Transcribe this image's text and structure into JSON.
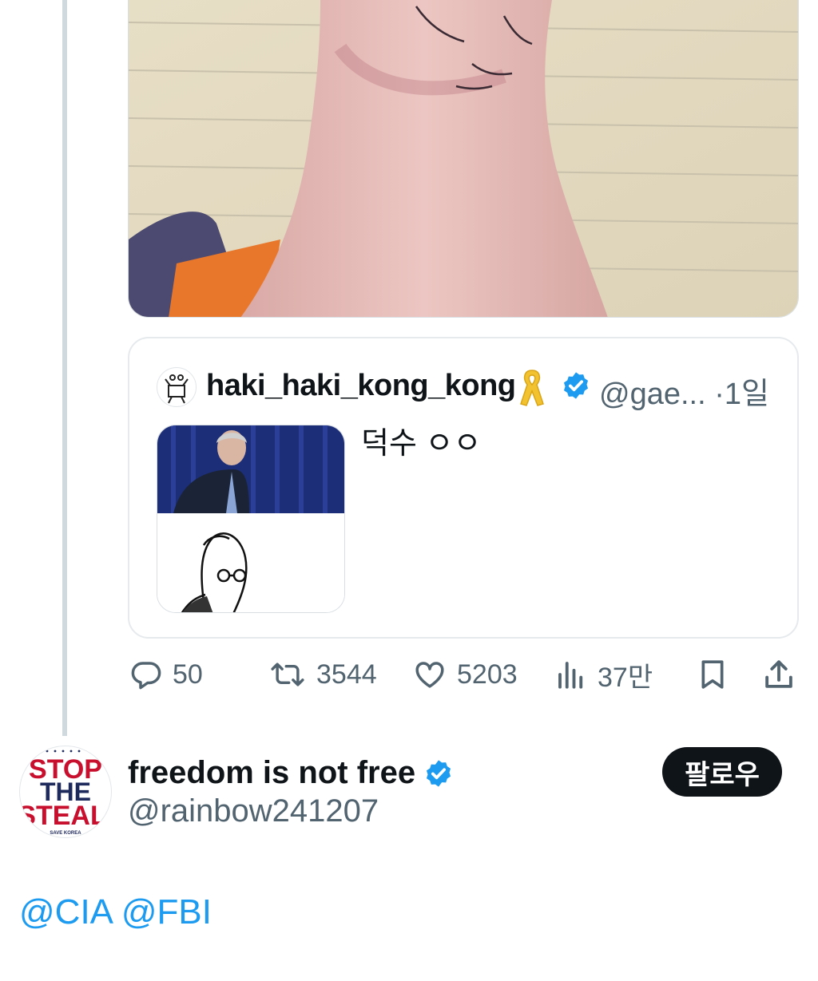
{
  "quoted_tweet": {
    "display_name": "haki_haki_kong_kong",
    "handle": "@gae...",
    "separator": "·",
    "time": "1일",
    "text": "덕수 ㅇㅇ"
  },
  "actions": {
    "replies": "50",
    "reposts": "3544",
    "likes": "5203",
    "views": "37만"
  },
  "next_tweet": {
    "display_name": "freedom is not free",
    "handle": "@rainbow241207",
    "follow_label": "팔로우",
    "avatar_text": [
      "STOP",
      "THE",
      "STEAL",
      "SAVE KOREA"
    ],
    "mentions": [
      "@CIA",
      "@FBI"
    ]
  },
  "colors": {
    "accent": "#1d9bf0",
    "text_primary": "#0f1419",
    "text_secondary": "#536471",
    "border": "#e6eaed",
    "verified": "#1d9bf0",
    "stop_red": "#c8102e",
    "stop_navy": "#1f2a5c"
  },
  "icons": [
    "reply-icon",
    "repost-icon",
    "like-icon",
    "views-icon",
    "bookmark-icon",
    "share-icon",
    "verified-badge-icon",
    "yellow-ribbon-icon"
  ]
}
